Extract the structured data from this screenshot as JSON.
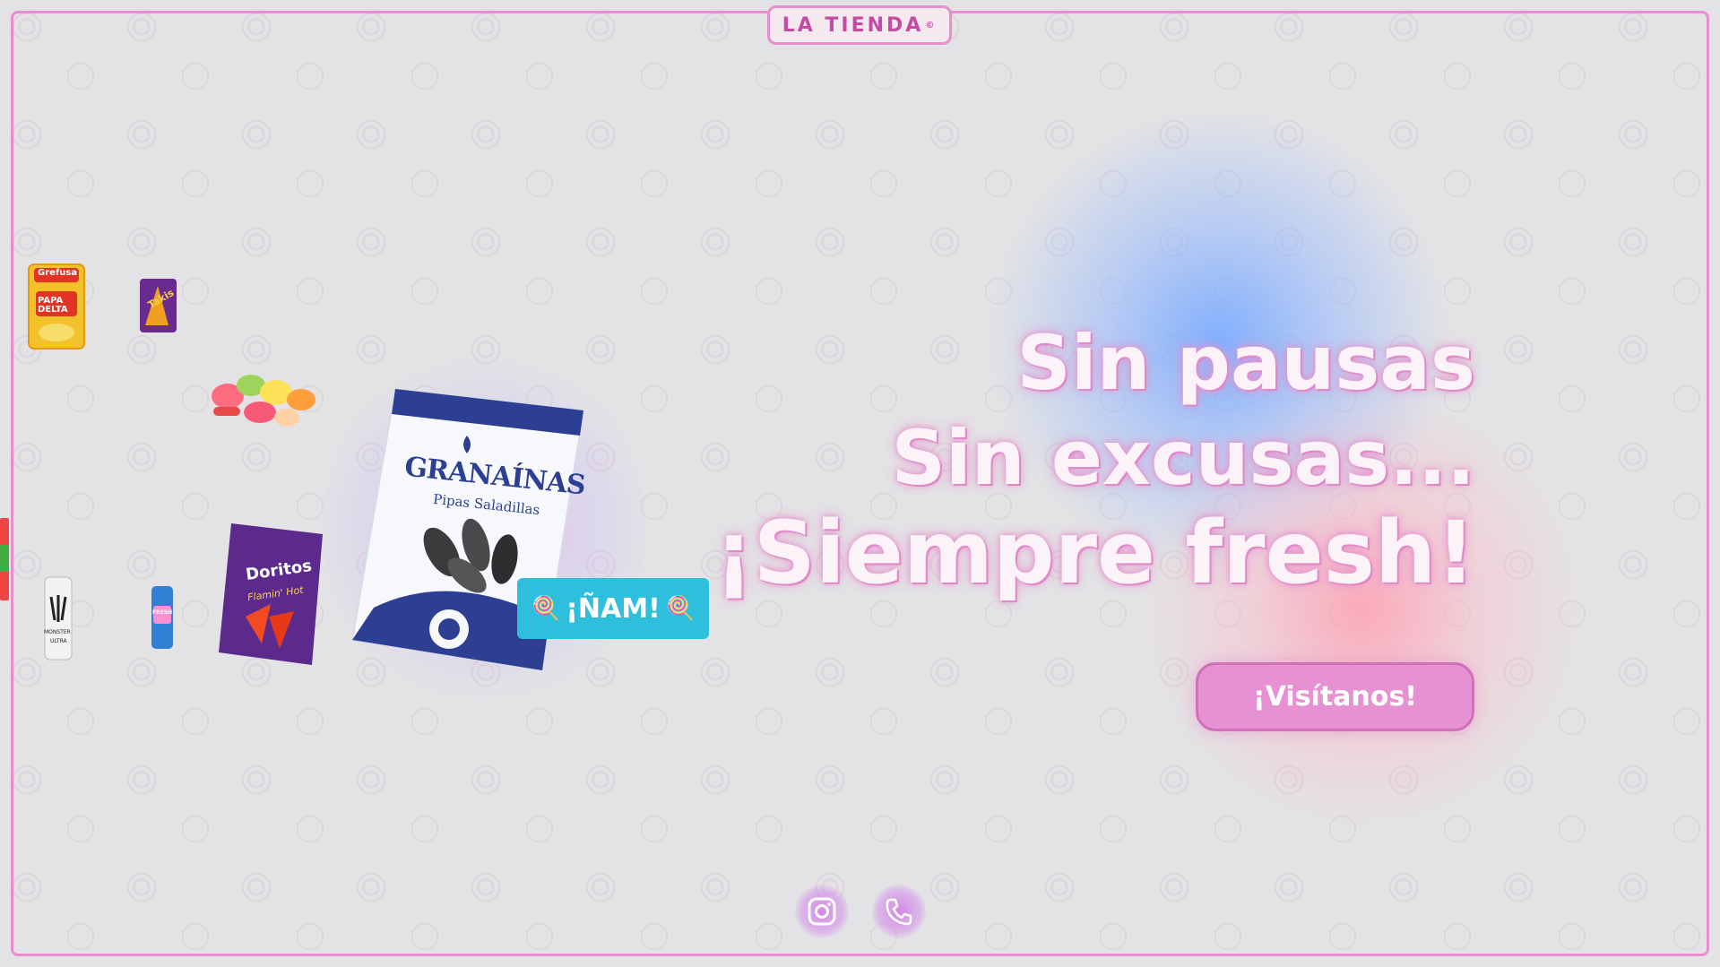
{
  "header": {
    "logo_text": "LA TIENDA",
    "logo_sup": "©"
  },
  "hero": {
    "line1": "Sin pausas",
    "line2": "Sin excusas...",
    "line3": "¡Siempre fresh!",
    "cta_label": "¡Visítanos!"
  },
  "promo": {
    "nam_label": "¡ÑAM!",
    "lolly_icon": "🍭"
  },
  "products": {
    "grefusa": {
      "brand": "Grefusa",
      "name": "PAPA DELTA"
    },
    "takis": {
      "name": "Takis"
    },
    "doritos": {
      "brand": "Doritos",
      "flavor": "Flamin' Hot"
    },
    "monster": {
      "name": "MONSTER",
      "sub": "ULTRA"
    },
    "fresh": {
      "name": "FRESH"
    },
    "granainas": {
      "brand": "GRANAÍNAS",
      "sub": "Pipas Saladillas"
    }
  },
  "footer": {
    "instagram_icon": "instagram-icon",
    "phone_icon": "phone-icon"
  },
  "colors": {
    "accent_pink": "#e78fce",
    "cta_bg": "#e591d2",
    "nam_bg": "#2ebfdc",
    "background": "#e3e3e5"
  }
}
